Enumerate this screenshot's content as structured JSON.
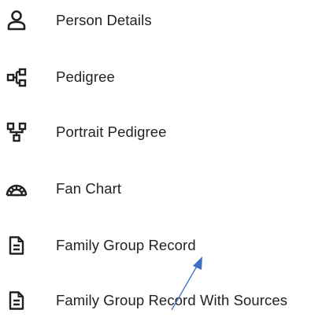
{
  "menu": {
    "items": [
      {
        "label": "Person Details",
        "icon": "person-icon"
      },
      {
        "label": "Pedigree",
        "icon": "pedigree-icon"
      },
      {
        "label": "Portrait Pedigree",
        "icon": "portrait-pedigree-icon"
      },
      {
        "label": "Fan Chart",
        "icon": "fan-chart-icon"
      },
      {
        "label": "Family Group Record",
        "icon": "document-icon"
      },
      {
        "label": "Family Group Record With Sources",
        "icon": "document-icon"
      }
    ]
  },
  "colors": {
    "icon": "#222222",
    "text": "#222222",
    "annotation_arrow": "#3b6fc4"
  }
}
